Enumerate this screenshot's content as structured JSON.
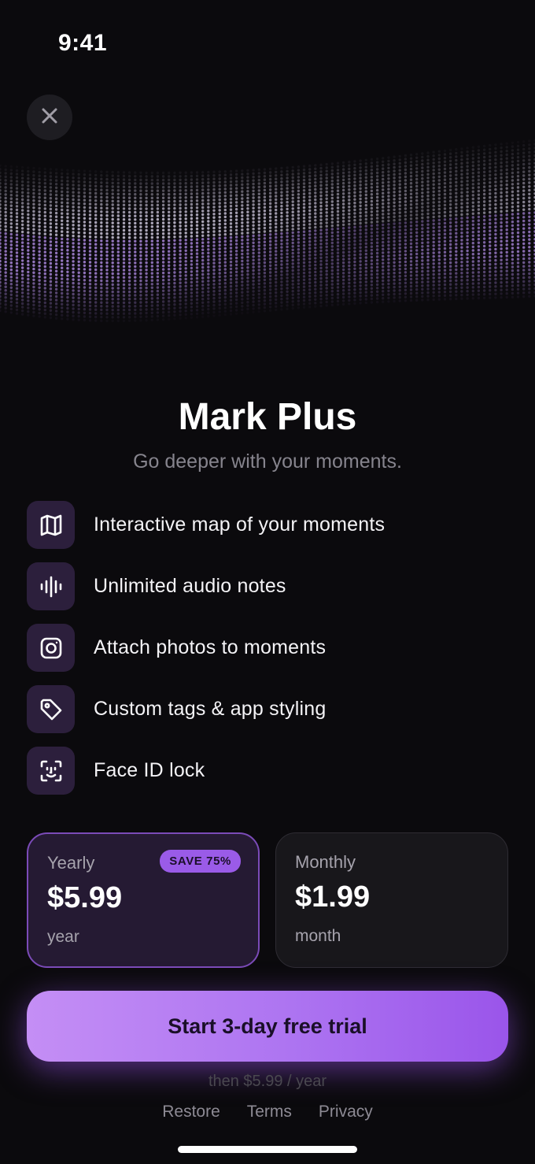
{
  "status_bar": {
    "time": "9:41"
  },
  "header": {
    "close_icon": "close-icon"
  },
  "hero": {
    "title": "Mark Plus",
    "subtitle": "Go deeper with your moments."
  },
  "features": [
    {
      "icon": "map-icon",
      "label": "Interactive map of your moments"
    },
    {
      "icon": "audio-waveform-icon",
      "label": "Unlimited audio notes"
    },
    {
      "icon": "camera-icon",
      "label": "Attach photos to moments"
    },
    {
      "icon": "tag-icon",
      "label": "Custom tags & app styling"
    },
    {
      "icon": "face-id-icon",
      "label": "Face ID lock"
    }
  ],
  "plans": {
    "yearly": {
      "name": "Yearly",
      "price": "$5.99",
      "period": "year",
      "badge": "SAVE 75%",
      "selected": true
    },
    "monthly": {
      "name": "Monthly",
      "price": "$1.99",
      "period": "month",
      "selected": false
    }
  },
  "cta": {
    "label": "Start 3-day free trial",
    "note": "then $5.99 / year"
  },
  "footer_links": {
    "restore": "Restore",
    "terms": "Terms",
    "privacy": "Privacy"
  },
  "colors": {
    "accent": "#a56ef0",
    "background": "#0b0a0d",
    "icon_tile": "#2c1f3c"
  }
}
